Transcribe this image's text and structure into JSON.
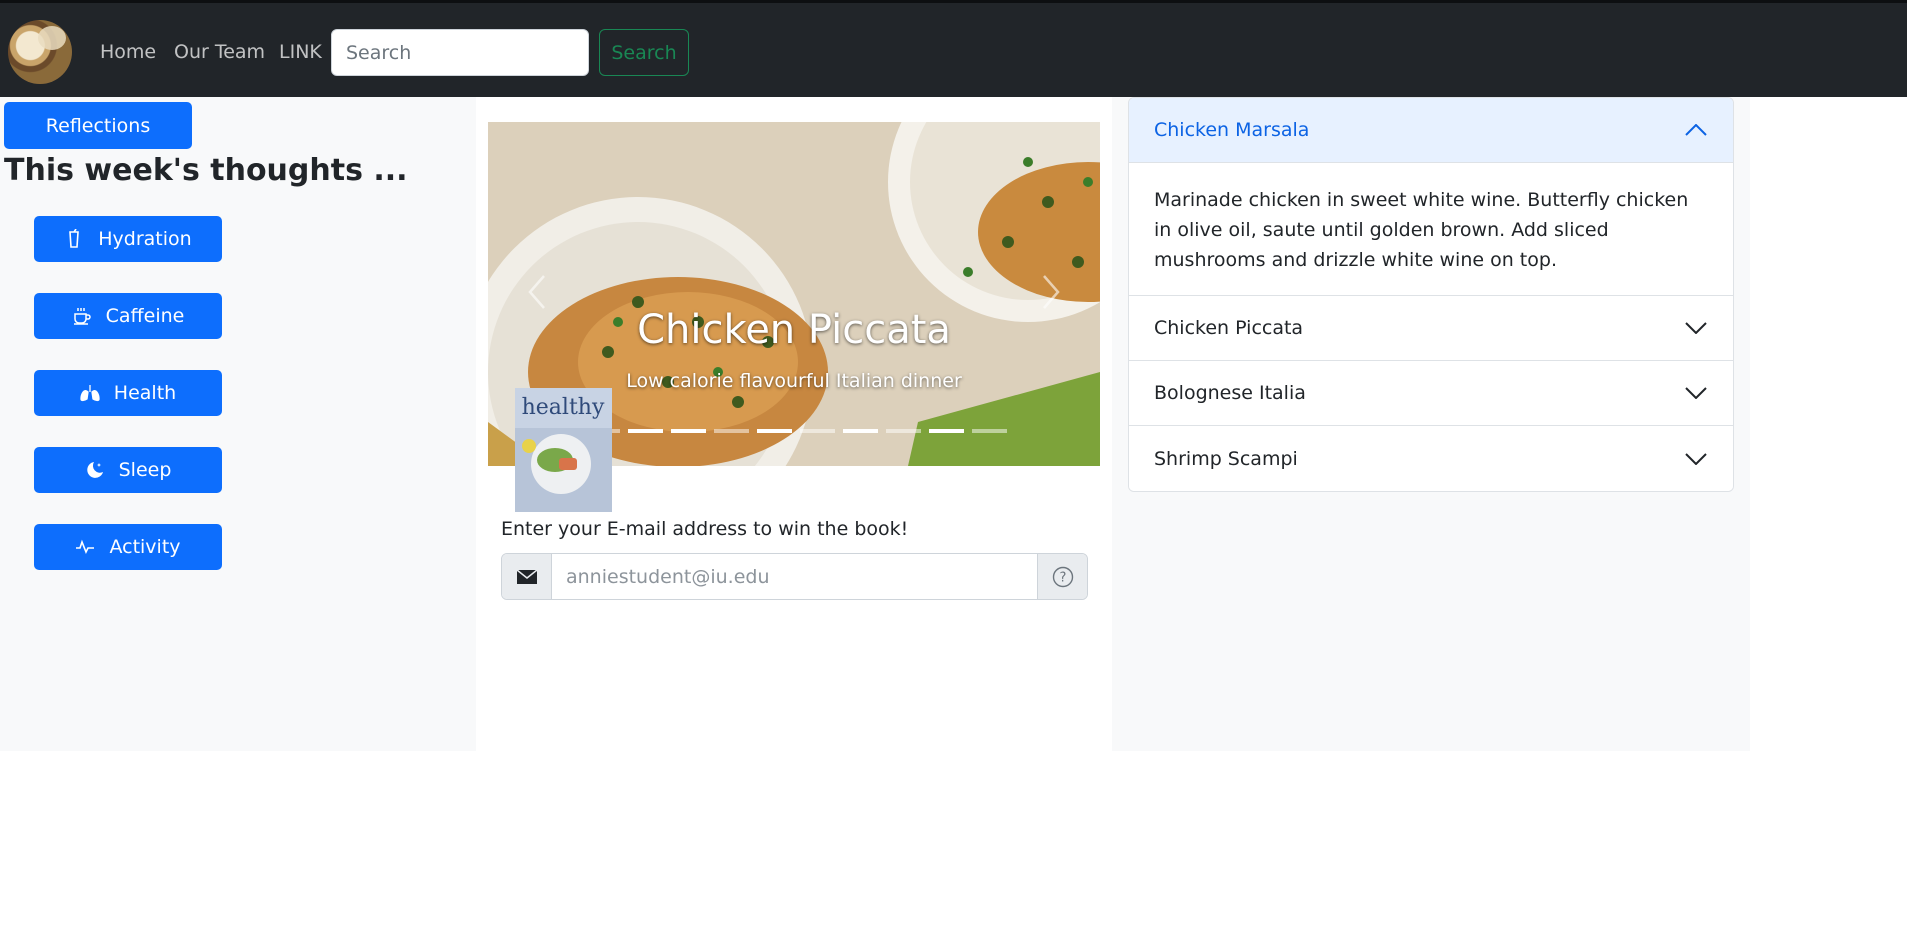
{
  "nav": {
    "links": [
      "Home",
      "Our Team",
      "LINK"
    ],
    "search_placeholder": "Search",
    "search_button": "Search"
  },
  "sidebar": {
    "reflections_button": "Reflections",
    "title": "This week's thoughts ...",
    "items": [
      {
        "label": "Hydration",
        "icon": "cup-icon"
      },
      {
        "label": "Caffeine",
        "icon": "coffee-cup-icon"
      },
      {
        "label": "Health",
        "icon": "lungs-icon"
      },
      {
        "label": "Sleep",
        "icon": "moon-stars-icon"
      },
      {
        "label": "Activity",
        "icon": "pulse-icon"
      }
    ]
  },
  "carousel": {
    "title": "Chicken Piccata",
    "caption": "Low calorie flavourful Italian dinner",
    "indicator_count": 10,
    "active_indicators": [
      1,
      2,
      4,
      6,
      8
    ]
  },
  "book": {
    "cover_text": "healthy"
  },
  "email": {
    "label": "Enter your E-mail address to win the book!",
    "placeholder": "anniestudent@iu.edu"
  },
  "accordion": {
    "items": [
      {
        "title": "Chicken Marsala",
        "open": true,
        "body": "Marinade chicken in sweet white wine. Butterfly chicken in olive oil, saute until golden brown. Add sliced mushrooms and drizzle white wine on top."
      },
      {
        "title": "Chicken Piccata",
        "open": false
      },
      {
        "title": "Bolognese Italia",
        "open": false
      },
      {
        "title": "Shrimp Scampi",
        "open": false
      }
    ]
  },
  "colors": {
    "navbar": "#212529",
    "primary": "#0d6efd",
    "success": "#198754",
    "accordion_active": "#e7f1ff"
  }
}
